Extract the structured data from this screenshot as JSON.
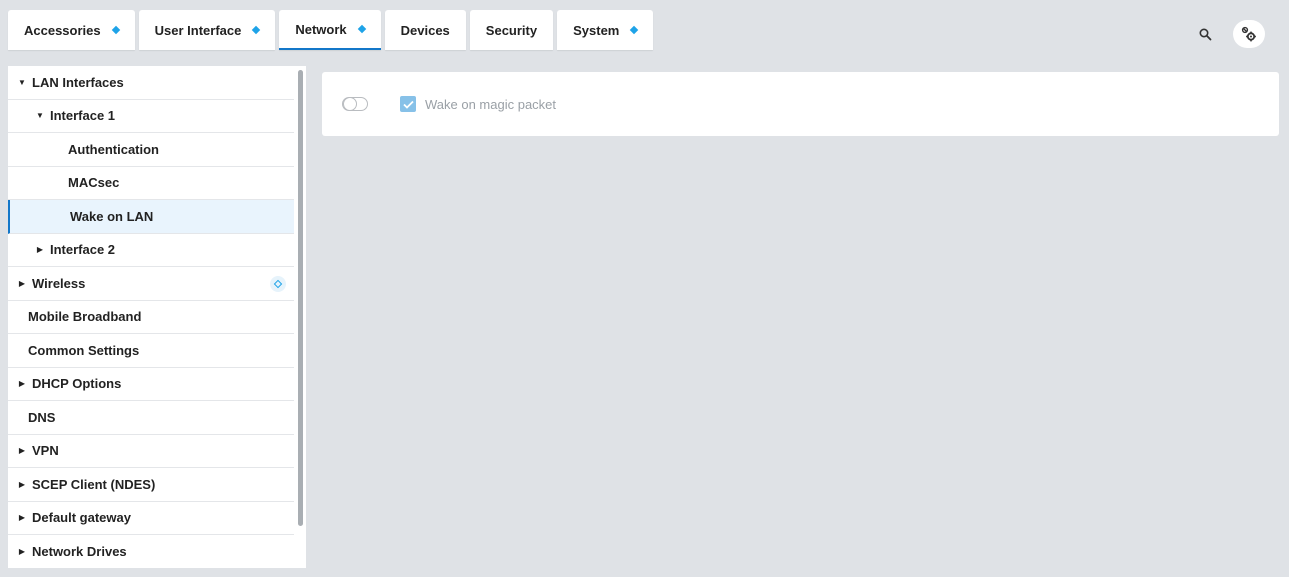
{
  "tabs": [
    {
      "label": "Accessories",
      "badge": true
    },
    {
      "label": "User Interface",
      "badge": true
    },
    {
      "label": "Network",
      "badge": true,
      "active": true
    },
    {
      "label": "Devices",
      "badge": false
    },
    {
      "label": "Security",
      "badge": false
    },
    {
      "label": "System",
      "badge": true
    }
  ],
  "header": {
    "search_icon": "search-icon",
    "settings_icon": "wrench-gear-icon"
  },
  "sidebar": {
    "items": [
      {
        "label": "LAN Interfaces",
        "level": 0,
        "arrow": "expanded"
      },
      {
        "label": "Interface 1",
        "level": 1,
        "arrow": "expanded"
      },
      {
        "label": "Authentication",
        "level": 2,
        "arrow": "none"
      },
      {
        "label": "MACsec",
        "level": 2,
        "arrow": "none"
      },
      {
        "label": "Wake on LAN",
        "level": 2,
        "arrow": "none",
        "selected": true
      },
      {
        "label": "Interface 2",
        "level": 1,
        "arrow": "collapsed"
      },
      {
        "label": "Wireless",
        "level": 0,
        "arrow": "collapsed",
        "badge": true
      },
      {
        "label": "Mobile Broadband",
        "level": 0,
        "arrow": "none"
      },
      {
        "label": "Common Settings",
        "level": 0,
        "arrow": "none"
      },
      {
        "label": "DHCP Options",
        "level": 0,
        "arrow": "collapsed"
      },
      {
        "label": "DNS",
        "level": 0,
        "arrow": "none"
      },
      {
        "label": "VPN",
        "level": 0,
        "arrow": "collapsed"
      },
      {
        "label": "SCEP Client (NDES)",
        "level": 0,
        "arrow": "collapsed"
      },
      {
        "label": "Default gateway",
        "level": 0,
        "arrow": "collapsed"
      },
      {
        "label": "Network Drives",
        "level": 0,
        "arrow": "collapsed"
      }
    ]
  },
  "content": {
    "toggle_on": false,
    "checkbox_checked": true,
    "checkbox_label": "Wake on magic packet"
  },
  "colors": {
    "accent": "#1377c9",
    "badge": "#1ea3e8",
    "background": "#dfe2e6"
  }
}
